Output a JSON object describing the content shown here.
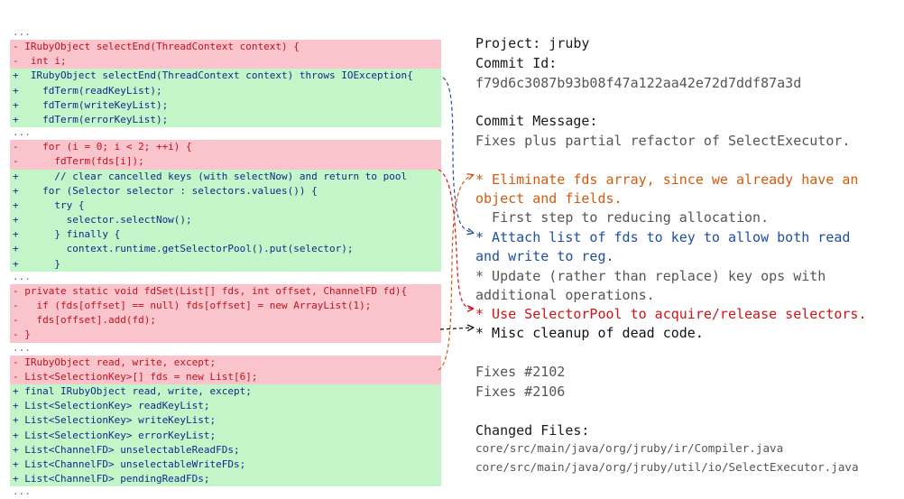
{
  "diff": {
    "lines": [
      {
        "type": "ctx",
        "text": "..."
      },
      {
        "type": "del",
        "text": "- IRubyObject selectEnd(ThreadContext context) {"
      },
      {
        "type": "del",
        "text": "-  int i;"
      },
      {
        "type": "add",
        "text": "+  IRubyObject selectEnd(ThreadContext context) throws IOException{"
      },
      {
        "type": "add",
        "text": "+    fdTerm(readKeyList);"
      },
      {
        "type": "add",
        "text": "+    fdTerm(writeKeyList);"
      },
      {
        "type": "add",
        "text": "+    fdTerm(errorKeyList);"
      },
      {
        "type": "ctx",
        "text": "..."
      },
      {
        "type": "del",
        "text": "-    for (i = 0; i < 2; ++i) {"
      },
      {
        "type": "del",
        "text": "-      fdTerm(fds[i]);"
      },
      {
        "type": "add",
        "text": "+      // clear cancelled keys (with selectNow) and return to pool"
      },
      {
        "type": "add",
        "text": "+    for (Selector selector : selectors.values()) {"
      },
      {
        "type": "add",
        "text": "+      try {"
      },
      {
        "type": "add",
        "text": "+        selector.selectNow();"
      },
      {
        "type": "add",
        "text": "+      } finally {"
      },
      {
        "type": "add",
        "text": "+        context.runtime.getSelectorPool().put(selector);"
      },
      {
        "type": "add",
        "text": "+      }"
      },
      {
        "type": "ctx",
        "text": "..."
      },
      {
        "type": "del",
        "text": "- private static void fdSet(List[] fds, int offset, ChannelFD fd){"
      },
      {
        "type": "del",
        "text": "-   if (fds[offset] == null) fds[offset] = new ArrayList(1);"
      },
      {
        "type": "del",
        "text": "-   fds[offset].add(fd);"
      },
      {
        "type": "del",
        "text": "- }"
      },
      {
        "type": "ctx",
        "text": "..."
      },
      {
        "type": "del",
        "text": "- IRubyObject read, write, except;"
      },
      {
        "type": "del",
        "text": "- List<SelectionKey>[] fds = new List[6];"
      },
      {
        "type": "add",
        "text": "+ final IRubyObject read, write, except;"
      },
      {
        "type": "add",
        "text": "+ List<SelectionKey> readKeyList;"
      },
      {
        "type": "add",
        "text": "+ List<SelectionKey> writeKeyList;"
      },
      {
        "type": "add",
        "text": "+ List<SelectionKey> errorKeyList;"
      },
      {
        "type": "add",
        "text": "+ List<ChannelFD> unselectableReadFDs;"
      },
      {
        "type": "add",
        "text": "+ List<ChannelFD> unselectableWriteFDs;"
      },
      {
        "type": "add",
        "text": "+ List<ChannelFD> pendingReadFDs;"
      },
      {
        "type": "ctx",
        "text": "..."
      }
    ]
  },
  "info": {
    "project": "Project: jruby",
    "commit_id_label": "Commit Id:",
    "commit_id": "f79d6c3087b93b08f47a122aa42e72d7ddf87a3d",
    "commit_message_label": "Commit Message:",
    "commit_message": "Fixes plus partial refactor of SelectExecutor.",
    "bullets": {
      "b1_line1": "* Eliminate fds array, since we already have an",
      "b1_line2": "object and fields.",
      "b1_line3": "  First step to reducing allocation.",
      "b2_line1": "* Attach list of fds to key to allow both read",
      "b2_line2": "and write to reg.",
      "b3_line1": "* Update (rather than replace) key ops with",
      "b3_line2": "additional operations.",
      "b4_line1": "* Use SelectorPool to acquire/release selectors.",
      "b5_line1": "* Misc cleanup of dead code."
    },
    "fixes_1": "Fixes #2102",
    "fixes_2": "Fixes #2106",
    "changed_files_label": "Changed Files:",
    "file_1": "core/src/main/java/org/jruby/ir/Compiler.java",
    "file_2": "core/src/main/java/org/jruby/util/io/SelectExecutor.java"
  },
  "colors": {
    "deletion_bg": "#f9c4cb",
    "addition_bg": "#c4f5c8",
    "deletion_text": "#c0121e",
    "addition_text": "#0c2c8c",
    "arrow_orange": "#d45a0d",
    "arrow_blue": "#1f4fa0",
    "arrow_red": "#d81010",
    "arrow_black": "#111111"
  }
}
